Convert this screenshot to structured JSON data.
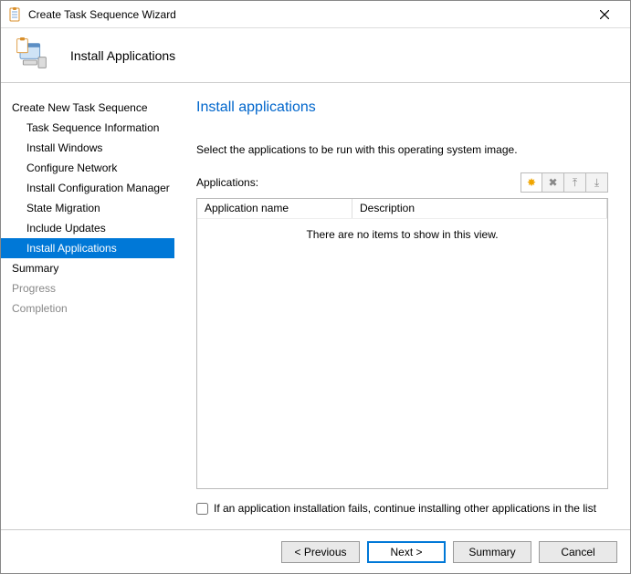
{
  "window": {
    "title": "Create Task Sequence Wizard"
  },
  "header": {
    "step_title": "Install Applications"
  },
  "sidebar": {
    "group1_label": "Create New Task Sequence",
    "group1_items": [
      "Task Sequence Information",
      "Install Windows",
      "Configure Network",
      "Install Configuration Manager",
      "State Migration",
      "Include Updates",
      "Install Applications"
    ],
    "selected_index": 6,
    "group2_items": [
      "Summary",
      "Progress",
      "Completion"
    ]
  },
  "main": {
    "title": "Install applications",
    "instructions": "Select the applications to be run with this operating system image.",
    "applications_label": "Applications:",
    "columns": {
      "name": "Application name",
      "description": "Description"
    },
    "empty_text": "There are no items to show in this view.",
    "checkbox_label": "If an application installation fails, continue installing other applications in the list",
    "checkbox_checked": false,
    "toolbar": {
      "new": "✸",
      "delete": "✖",
      "up": "⤒",
      "down": "⤓"
    }
  },
  "footer": {
    "previous": "< Previous",
    "next": "Next >",
    "summary": "Summary",
    "cancel": "Cancel"
  }
}
